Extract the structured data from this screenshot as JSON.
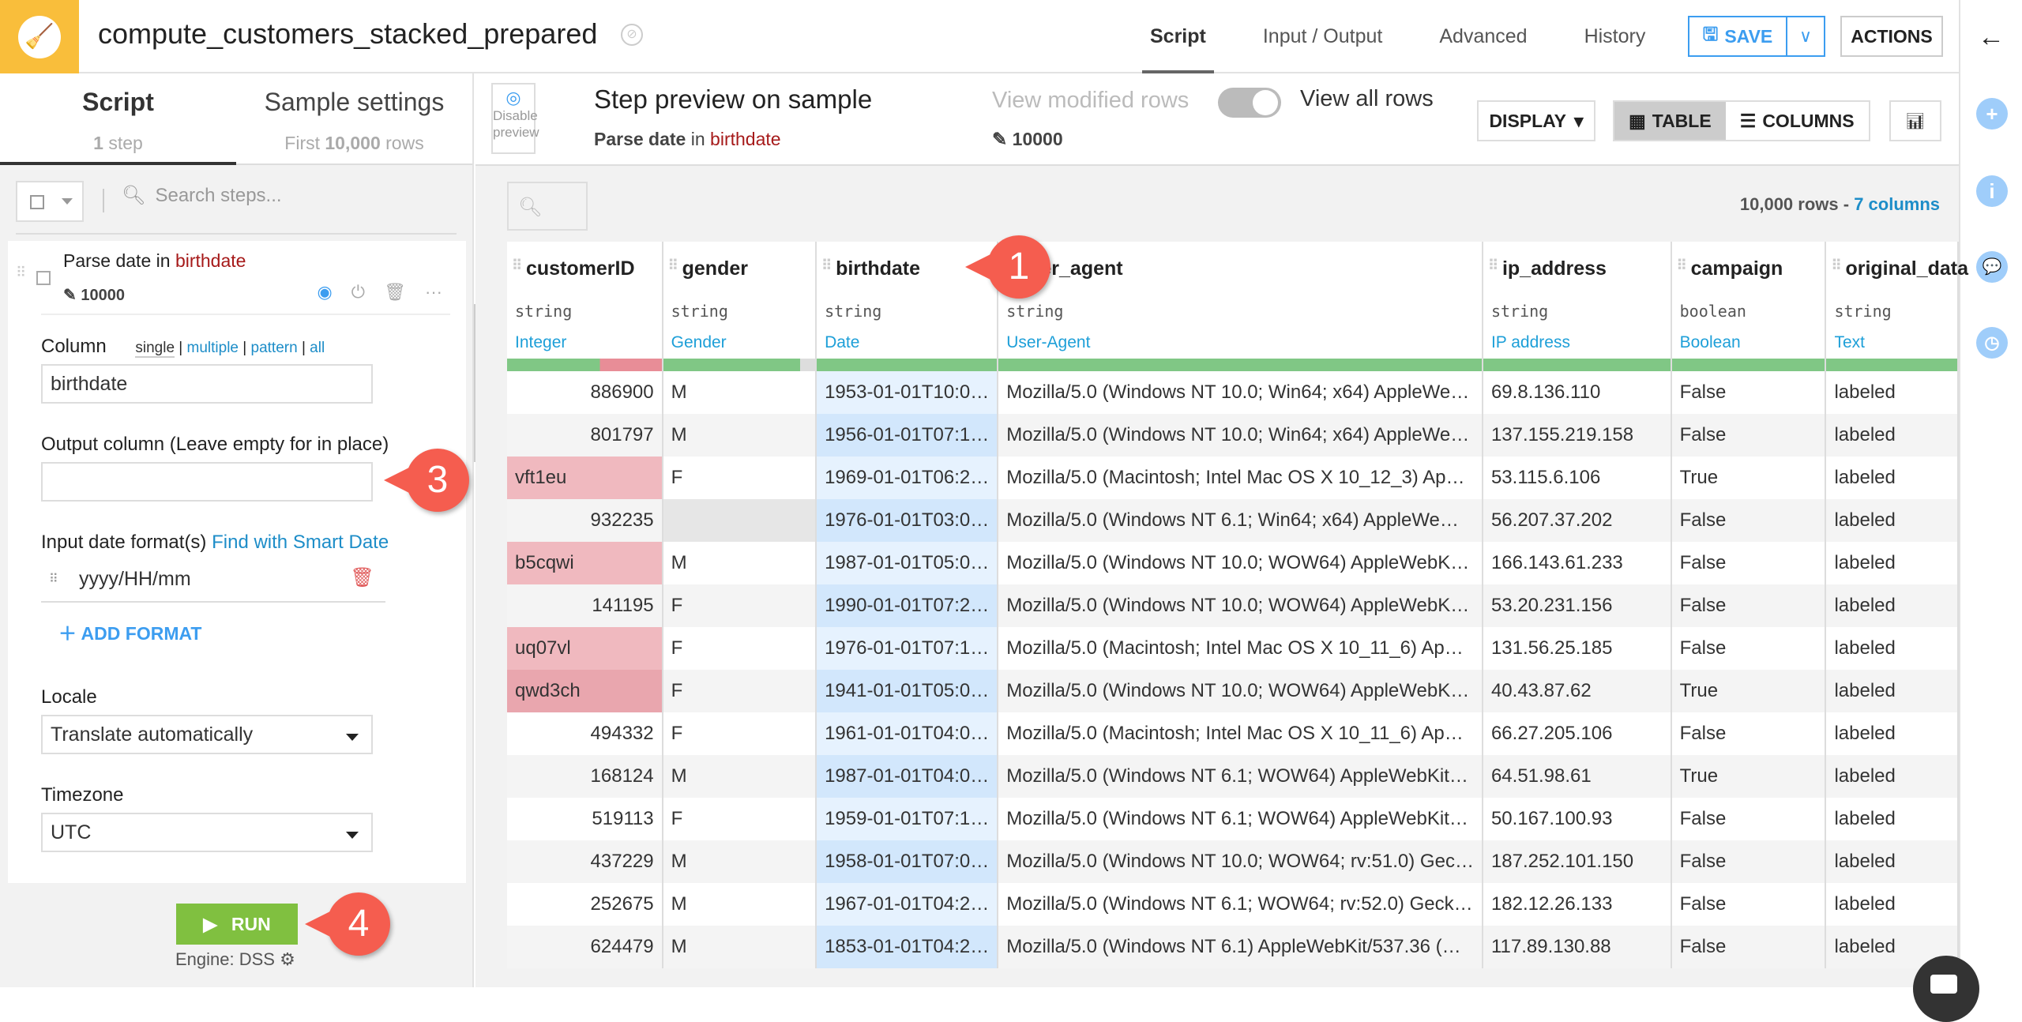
{
  "header": {
    "title": "compute_customers_stacked_prepared",
    "logo_icon": "broom-icon",
    "tabs": [
      "Script",
      "Input / Output",
      "Advanced",
      "History"
    ],
    "active_tab": "Script",
    "save_label": "SAVE",
    "actions_label": "ACTIONS"
  },
  "left_panel": {
    "tabs": [
      {
        "label": "Script",
        "sub_count": "1",
        "sub_text": "step"
      },
      {
        "label": "Sample settings",
        "sub_prefix": "First",
        "sub_count": "10,000",
        "sub_text": "rows"
      }
    ],
    "search_placeholder": "Search steps...",
    "step": {
      "action": "Parse date",
      "in": "in",
      "column": "birthdate",
      "count": "10000"
    },
    "form": {
      "column_label": "Column",
      "modes": [
        "single",
        "multiple",
        "pattern",
        "all"
      ],
      "column_value": "birthdate",
      "output_label": "Output column (Leave empty for in place)",
      "output_value": "",
      "formats_label": "Input date format(s)",
      "smart_date_link": "Find with Smart Date",
      "formats": [
        "yyyy/HH/mm"
      ],
      "add_format_label": "ADD FORMAT",
      "locale_label": "Locale",
      "locale_value": "Translate automatically",
      "timezone_label": "Timezone",
      "timezone_value": "UTC"
    },
    "run_label": "RUN",
    "engine_label": "Engine: DSS"
  },
  "preview": {
    "disable_label_1": "Disable",
    "disable_label_2": "preview",
    "title": "Step preview on sample",
    "sub_action": "Parse date",
    "sub_in": "in",
    "sub_column": "birthdate",
    "view_modified": "View modified rows",
    "view_all": "View all rows",
    "modified_count": "10000",
    "display_label": "DISPLAY",
    "table_label": "TABLE",
    "columns_label": "COLUMNS"
  },
  "table": {
    "row_count": "10,000 rows",
    "col_count": "7 columns",
    "columns": [
      {
        "name": "customerID",
        "type": "string",
        "meaning": "Integer"
      },
      {
        "name": "gender",
        "type": "string",
        "meaning": "Gender"
      },
      {
        "name": "birthdate",
        "type": "string",
        "meaning": "Date"
      },
      {
        "name": "user_agent",
        "type": "string",
        "meaning": "User-Agent"
      },
      {
        "name": "ip_address",
        "type": "string",
        "meaning": "IP address"
      },
      {
        "name": "campaign",
        "type": "boolean",
        "meaning": "Boolean"
      },
      {
        "name": "original_data",
        "type": "string",
        "meaning": "Text"
      }
    ],
    "rows": [
      [
        "886900",
        "M",
        "1953-01-01T10:0…",
        "Mozilla/5.0 (Windows NT 10.0; Win64; x64) AppleWe…",
        "69.8.136.110",
        "False",
        "labeled"
      ],
      [
        "801797",
        "M",
        "1956-01-01T07:1…",
        "Mozilla/5.0 (Windows NT 10.0; Win64; x64) AppleWe…",
        "137.155.219.158",
        "False",
        "labeled"
      ],
      [
        "vft1eu",
        "F",
        "1969-01-01T06:2…",
        "Mozilla/5.0 (Macintosh; Intel Mac OS X 10_12_3) Ap…",
        "53.115.6.106",
        "True",
        "labeled"
      ],
      [
        "932235",
        "",
        "1976-01-01T03:0…",
        "Mozilla/5.0 (Windows NT 6.1; Win64; x64) AppleWe…",
        "56.207.37.202",
        "False",
        "labeled"
      ],
      [
        "b5cqwi",
        "M",
        "1987-01-01T05:0…",
        "Mozilla/5.0 (Windows NT 10.0; WOW64) AppleWebK…",
        "166.143.61.233",
        "False",
        "labeled"
      ],
      [
        "141195",
        "F",
        "1990-01-01T07:2…",
        "Mozilla/5.0 (Windows NT 10.0; WOW64) AppleWebK…",
        "53.20.231.156",
        "False",
        "labeled"
      ],
      [
        "uq07vl",
        "F",
        "1976-01-01T07:1…",
        "Mozilla/5.0 (Macintosh; Intel Mac OS X 10_11_6) Ap…",
        "131.56.25.185",
        "False",
        "labeled"
      ],
      [
        "qwd3ch",
        "F",
        "1941-01-01T05:0…",
        "Mozilla/5.0 (Windows NT 10.0; WOW64) AppleWebK…",
        "40.43.87.62",
        "True",
        "labeled"
      ],
      [
        "494332",
        "F",
        "1961-01-01T04:0…",
        "Mozilla/5.0 (Macintosh; Intel Mac OS X 10_11_6) Ap…",
        "66.27.205.106",
        "False",
        "labeled"
      ],
      [
        "168124",
        "M",
        "1987-01-01T04:0…",
        "Mozilla/5.0 (Windows NT 6.1; WOW64) AppleWebKit…",
        "64.51.98.61",
        "True",
        "labeled"
      ],
      [
        "519113",
        "F",
        "1959-01-01T07:1…",
        "Mozilla/5.0 (Windows NT 6.1; WOW64) AppleWebKit…",
        "50.167.100.93",
        "False",
        "labeled"
      ],
      [
        "437229",
        "M",
        "1958-01-01T07:0…",
        "Mozilla/5.0 (Windows NT 10.0; WOW64; rv:51.0) Gec…",
        "187.252.101.150",
        "False",
        "labeled"
      ],
      [
        "252675",
        "M",
        "1967-01-01T04:2…",
        "Mozilla/5.0 (Windows NT 6.1; WOW64; rv:52.0) Geck…",
        "182.12.26.133",
        "False",
        "labeled"
      ],
      [
        "624479",
        "M",
        "1853-01-01T04:2…",
        "Mozilla/5.0 (Windows NT 6.1) AppleWebKit/537.36 (…",
        "117.89.130.88",
        "False",
        "labeled"
      ]
    ],
    "invalid_rows": [
      2,
      4,
      6,
      7
    ]
  },
  "callouts": [
    "1",
    "3",
    "4"
  ],
  "colors": {
    "brand": "#f9be3b",
    "accent": "#3c9df0",
    "run": "#80c040",
    "callout": "#f55d4f",
    "invalid": "#f0b9bf",
    "valid_bar": "#80c785"
  }
}
